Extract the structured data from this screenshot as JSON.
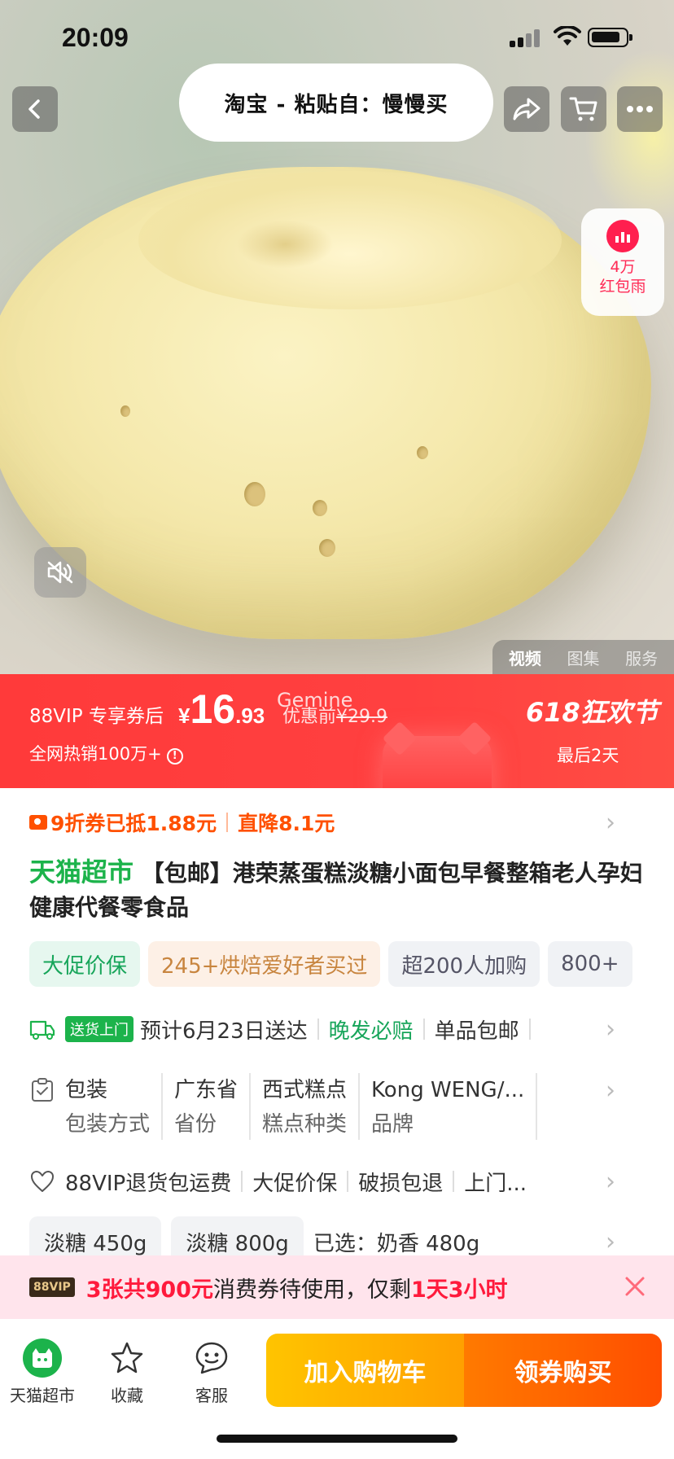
{
  "status_bar": {
    "time": "20:09"
  },
  "header": {
    "source_label": "淘宝 - 粘贴自：慢慢买"
  },
  "red_rain": {
    "line1": "4万",
    "line2": "红包雨"
  },
  "media_tabs": [
    "视频",
    "图集",
    "服务"
  ],
  "price": {
    "prefix": "88VIP 专享券后",
    "currency": "¥",
    "integer": "16",
    "decimal": ".93",
    "before_label": "优惠前",
    "before_value": "¥29.9",
    "watermark": "Gemine",
    "sales": "全网热销100万+",
    "festival": "618狂欢节",
    "days_left": "最后2天"
  },
  "coupon": {
    "discount": "9折券已抵1.88元",
    "direct": "直降8.1元"
  },
  "title": {
    "brand": "天猫超市",
    "text": "【包邮】港荣蒸蛋糕淡糖小面包早餐整箱老人孕妇健康代餐零食品"
  },
  "tags": [
    "大促价保",
    "245+烘焙爱好者买过",
    "超200人加购",
    "800+"
  ],
  "delivery": {
    "badge": "送货上门",
    "eta": "预计6月23日送达",
    "late": "晚发必赔",
    "shipping": "单品包邮"
  },
  "specs": [
    {
      "value": "包装",
      "key": "包装方式"
    },
    {
      "value": "广东省",
      "key": "省份"
    },
    {
      "value": "西式糕点",
      "key": "糕点种类"
    },
    {
      "value": "Kong WENG/...",
      "key": "品牌"
    }
  ],
  "services": [
    "88VIP退货包运费",
    "大促价保",
    "破损包退",
    "上门..."
  ],
  "variants": {
    "options": [
      "淡糖 450g",
      "淡糖 800g"
    ],
    "selected": "已选：奶香 480g"
  },
  "promo": {
    "badge": "88VIP",
    "highlight1": "3张共900元",
    "middle": "消费券待使用，仅剩",
    "highlight2": "1天3小时"
  },
  "bottom_bar": {
    "tmall": "天猫超市",
    "favorite": "收藏",
    "service": "客服",
    "add_to_cart": "加入购物车",
    "buy": "领券购买"
  },
  "colors": {
    "price_red": "#ff3a3a",
    "coupon_orange": "#ff5000",
    "tmall_green": "#1cb34b",
    "cart_yellow": "#ffb300",
    "buy_orange": "#ff5a00"
  }
}
